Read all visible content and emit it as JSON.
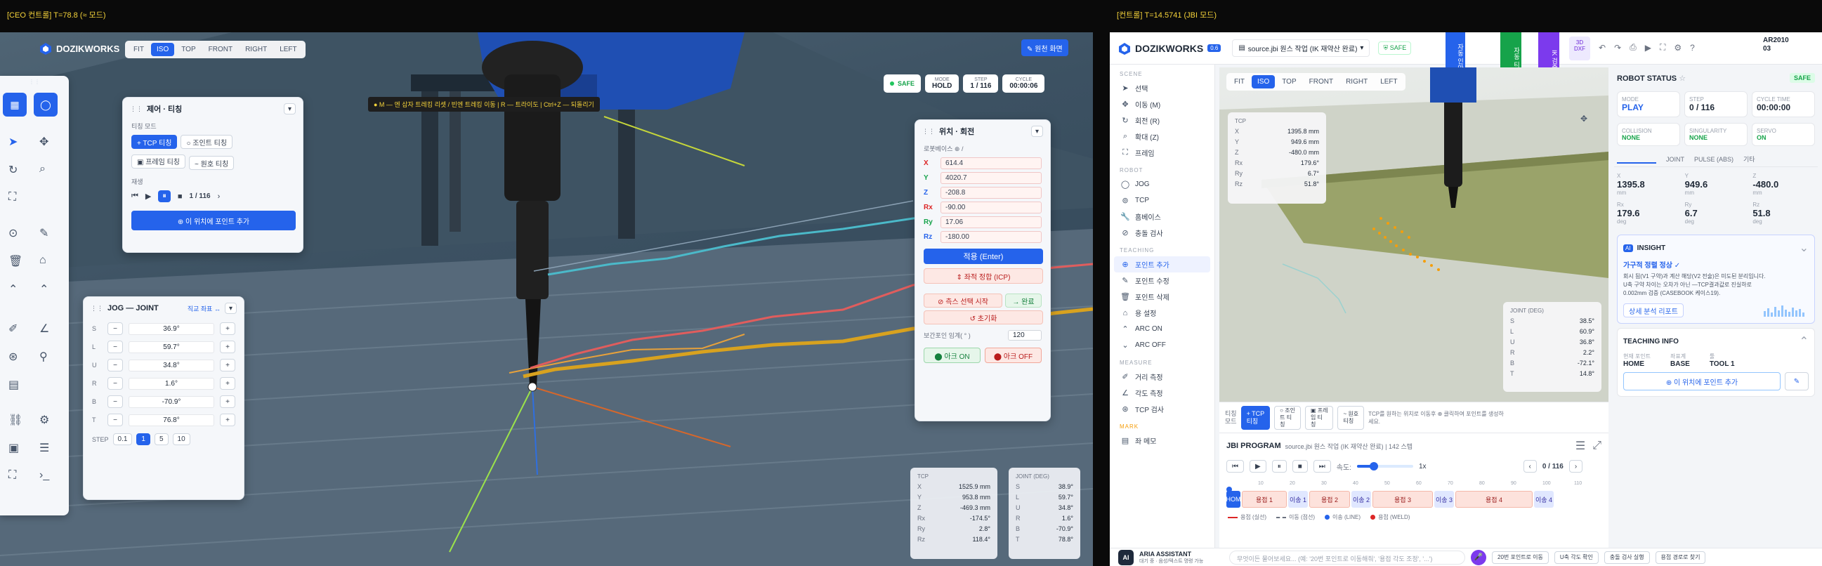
{
  "topbars": {
    "left": "[CEO 컨트롤] T=78.8 (≈ 모드)",
    "right": "[컨트롤] T=14.5741 (JBI 모드)"
  },
  "left": {
    "brand": "DOZIKWORKS",
    "views": [
      "FIT",
      "ISO",
      "TOP",
      "FRONT",
      "RIGHT",
      "LEFT"
    ],
    "active_view": "ISO",
    "return_btn": "✎ 원천 화면",
    "status": {
      "safe": "SAFE",
      "mode_label": "MODE",
      "mode": "HOLD",
      "step_label": "STEP",
      "step": "1 / 116",
      "cycle_label": "CYCLE",
      "cycle": "00:00:06"
    },
    "hint": "● M — 엔 삽자 트레킹 리셋 / 빈엔 트레킹 이동 | R — 트라이도 | Ctrl+Z — 되돌리기",
    "teach_panel": {
      "title": "제어 · 티칭",
      "mode_label": "티칭 모드",
      "modes": [
        "+ TCP 티칭",
        "○ 조인트 티칭",
        "▣ 프레임 티칭",
        "~ 원호 티칭"
      ],
      "play_label": "재생",
      "step": "1 / 116",
      "add_point": "⊕ 이 위치에 포인트 추가"
    },
    "jog_panel": {
      "title": "JOG — JOINT",
      "link": "직교 좌표 ↔",
      "joints": [
        {
          "name": "S",
          "value": "36.9°"
        },
        {
          "name": "L",
          "value": "59.7°"
        },
        {
          "name": "U",
          "value": "34.8°"
        },
        {
          "name": "R",
          "value": "1.6°"
        },
        {
          "name": "B",
          "value": "-70.9°"
        },
        {
          "name": "T",
          "value": "76.8°"
        }
      ],
      "step_label": "STEP",
      "steps": [
        "0.1",
        "1",
        "5",
        "10"
      ],
      "active_step": "1"
    },
    "pos_panel": {
      "title": "위치 · 회전",
      "frame_label": "로봇베이스  ⊕  /",
      "fields": [
        {
          "name": "X",
          "value": "614.4",
          "color": "#dc2626"
        },
        {
          "name": "Y",
          "value": "4020.7",
          "color": "#16a34a"
        },
        {
          "name": "Z",
          "value": "-208.8",
          "color": "#2563eb"
        },
        {
          "name": "Rx",
          "value": "-90.00",
          "color": "#dc2626"
        },
        {
          "name": "Ry",
          "value": "17.06",
          "color": "#16a34a"
        },
        {
          "name": "Rz",
          "value": "-180.00",
          "color": "#2563eb"
        }
      ],
      "apply": "적용 (Enter)",
      "align": "⇕ 좌적 정합 (ICP)",
      "measure": "⊘ 측스 선택 시작",
      "measure2": "→ 완료",
      "reset": "↺ 초기화",
      "tol_label": "보간포인 임계( ° )",
      "tol_value": "120",
      "arc_on": "⬤ 아크 ON",
      "arc_off": "⬤ 아크 OFF"
    },
    "tcp_box": {
      "title": "TCP",
      "rows": [
        {
          "k": "X",
          "v": "1525.9 mm"
        },
        {
          "k": "Y",
          "v": "953.8 mm"
        },
        {
          "k": "Z",
          "v": "-469.3 mm"
        },
        {
          "k": "Rx",
          "v": "-174.5°"
        },
        {
          "k": "Ry",
          "v": "2.8°"
        },
        {
          "k": "Rz",
          "v": "118.4°"
        }
      ]
    },
    "joint_box": {
      "title": "JOINT (DEG)",
      "rows": [
        {
          "k": "S",
          "v": "38.9°"
        },
        {
          "k": "L",
          "v": "59.7°"
        },
        {
          "k": "U",
          "v": "34.8°"
        },
        {
          "k": "R",
          "v": "1.6°"
        },
        {
          "k": "B",
          "v": "-70.9°"
        },
        {
          "k": "T",
          "v": "78.8°"
        }
      ]
    }
  },
  "right": {
    "brand": "DOZIKWORKS",
    "badge": "0.6",
    "file": "source.jbi 원스 작업 (IK 재약산 완료)",
    "safe": "SAFE",
    "head_tabs": [
      "자동 인아툰",
      "자동 티칭",
      "IK 검증",
      "3D DXF"
    ],
    "id": "AR2010\n03",
    "views": [
      "FIT",
      "ISO",
      "TOP",
      "FRONT",
      "RIGHT",
      "LEFT"
    ],
    "active_view": "ISO",
    "sidebar": {
      "scene": "SCENE",
      "scene_items": [
        "선택",
        "이동 (M)",
        "회전 (R)",
        "확대 (Z)",
        "프레임"
      ],
      "robot": "ROBOT",
      "robot_items": [
        "JOG",
        "TCP",
        "홈베이스",
        "충돌 검사"
      ],
      "teaching": "TEACHING",
      "teaching_items": [
        "포인트 추가",
        "포인트 수정",
        "포인트 삭제",
        "용 설정",
        "ARC ON",
        "ARC OFF"
      ],
      "measure": "MEASURE",
      "measure_items": [
        "거리 측정",
        "각도 측정",
        "TCP 검사"
      ],
      "mark": "MARK",
      "mark_items": [
        "좌 메모"
      ]
    },
    "tcp_overlay": {
      "title": "TCP",
      "rows": [
        {
          "k": "X",
          "v": "1395.8 mm"
        },
        {
          "k": "Y",
          "v": "949.6 mm"
        },
        {
          "k": "Z",
          "v": "-480.0 mm"
        },
        {
          "k": "Rx",
          "v": "179.6°"
        },
        {
          "k": "Ry",
          "v": "6.7°"
        },
        {
          "k": "Rz",
          "v": "51.8°"
        }
      ]
    },
    "joint_overlay": {
      "title": "JOINT (DEG)",
      "rows": [
        {
          "k": "S",
          "v": "38.5°"
        },
        {
          "k": "L",
          "v": "60.9°"
        },
        {
          "k": "U",
          "v": "36.8°"
        },
        {
          "k": "R",
          "v": "2.2°"
        },
        {
          "k": "B",
          "v": "-72.1°"
        },
        {
          "k": "T",
          "v": "14.8°"
        }
      ]
    },
    "teach_bar": {
      "label": "티칭\n모드",
      "modes": [
        "+ TCP\n티칭",
        "○ 조인\n트 티\n칭",
        "▣ 프레\n임 티\n칭",
        "~ 원호\n티칭"
      ],
      "hint": "TCP를 원하는 위치로 이동후 ⊕ 클릭하여 포인트를 생성하세요."
    },
    "program": {
      "title": "JBI PROGRAM",
      "file": "source.jbi 원스 작업 (IK 재약산 완료) | 142 스텝",
      "speed_label": "속도:",
      "speed": "1x",
      "step": "0 / 116",
      "ticks": [
        "10",
        "20",
        "30",
        "40",
        "50",
        "60",
        "70",
        "80",
        "90",
        "100",
        "110"
      ],
      "segments": [
        "HOM",
        "용접 1",
        "이송 1",
        "용접 2",
        "이송 2",
        "용접 3",
        "이송 3",
        "용접 4",
        "이송 4"
      ],
      "legend": [
        "용접 (실선)",
        "이동 (점선)",
        "이송 (LINE)",
        "용접 (WELD)"
      ]
    },
    "assistant": {
      "name": "ARIA ASSISTANT",
      "sub": "대기 중 · 음성/텍스트 명령 가능",
      "placeholder": "무엇이든 물어보세요... (예: '20번 포인트로 이동해줘', '용접 각도 조정', '...')",
      "chips": [
        "20번 포인트로 이동",
        "U축 각도 확인",
        "충돌 검사 실행",
        "용접 경로로 찾기"
      ]
    },
    "status": {
      "title": "ROBOT STATUS",
      "safe": "SAFE",
      "mode_label": "MODE",
      "mode": "PLAY",
      "step_label": "STEP",
      "step": "0 / 116",
      "cycle_label": "CYCLE TIME",
      "cycle": "00:00:00",
      "collision_label": "COLLISION",
      "collision": "NONE",
      "sing_label": "SINGULARITY",
      "sing": "NONE",
      "servo_label": "SERVO",
      "servo": "ON",
      "tabs": [
        "",
        "JOINT",
        "PULSE (ABS)",
        "기타"
      ],
      "coords": [
        {
          "k": "X",
          "v": "1395.8",
          "u": "mm"
        },
        {
          "k": "Y",
          "v": "949.6",
          "u": "mm"
        },
        {
          "k": "Z",
          "v": "-480.0",
          "u": "mm"
        },
        {
          "k": "Rx",
          "v": "179.6",
          "u": "deg"
        },
        {
          "k": "Ry",
          "v": "6.7",
          "u": "deg"
        },
        {
          "k": "Rz",
          "v": "51.8",
          "u": "deg"
        }
      ]
    },
    "insight": {
      "title": "INSIGHT",
      "headline": "가구적 정렬 정상 ✓",
      "body": "회시 됨(V1 구약)과 계산 해당(V2 전술)은 미도된 분리입니다.\nU축 구약 차이는 오차가 아닌 —TCP결과값로 진실하로\n0.002mm 검증 (CASEBOOK 케이스19).",
      "btn": "상세 분석 리포트"
    },
    "teach_info": {
      "title": "TEACHING INFO",
      "cols": [
        {
          "k": "현재 포인트",
          "v": "HOME"
        },
        {
          "k": "좌표계",
          "v": "BASE"
        },
        {
          "k": "툴",
          "v": "TOOL 1"
        }
      ],
      "add": "⊕ 이 위치에 포인트 추가"
    }
  }
}
